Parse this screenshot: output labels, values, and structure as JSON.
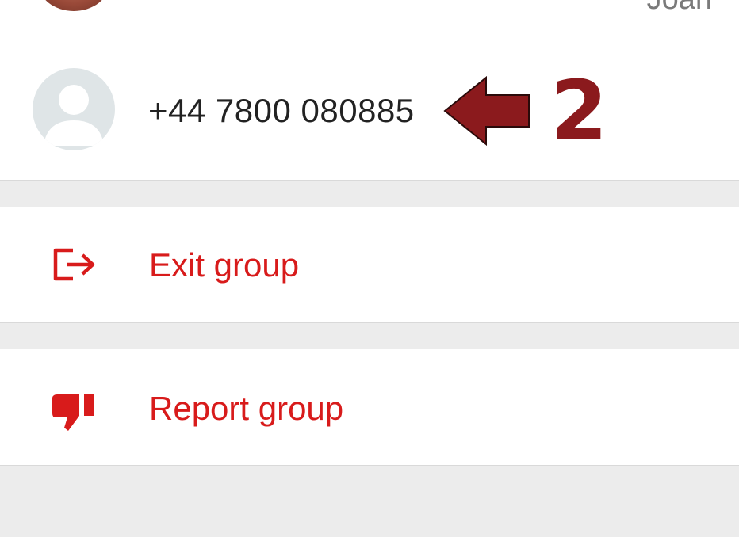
{
  "participants": {
    "previous_contact_name": "Joan",
    "contact": {
      "phone": "+44 7800 080885",
      "avatar_icon": "default-person-avatar"
    }
  },
  "annotation": {
    "number": "2",
    "color": "#8b1a1d",
    "arrow_icon": "left-arrow-icon"
  },
  "actions": {
    "exit_group": {
      "label": "Exit group",
      "icon": "exit-icon"
    },
    "report_group": {
      "label": "Report group",
      "icon": "thumbs-down-icon"
    }
  },
  "colors": {
    "danger": "#d81b1b",
    "background": "#ececec",
    "card": "#ffffff"
  }
}
